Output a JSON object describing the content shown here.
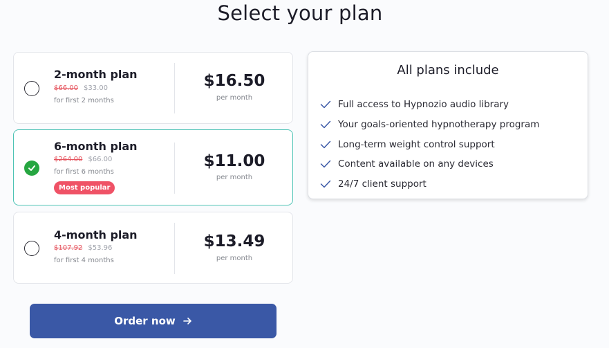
{
  "page": {
    "title": "Select your plan"
  },
  "plans": [
    {
      "name": "2-month plan",
      "old_price": "$66.00",
      "new_price": "$33.00",
      "period": "for first 2 months",
      "price": "$16.50",
      "per": "per month",
      "selected": false
    },
    {
      "name": "6-month plan",
      "old_price": "$264.00",
      "new_price": "$66.00",
      "period": "for first 6 months",
      "badge": "Most popular",
      "price": "$11.00",
      "per": "per month",
      "selected": true
    },
    {
      "name": "4-month plan",
      "old_price": "$107.92",
      "new_price": "$53.96",
      "period": "for first 4 months",
      "price": "$13.49",
      "per": "per month",
      "selected": false
    }
  ],
  "order": {
    "label": "Order now",
    "icon": "arrow-right-icon"
  },
  "includes": {
    "title": "All plans include",
    "items": [
      "Full access to Hypnozio audio library",
      "Your goals-oriented hypnotherapy program",
      "Long-term weight control support",
      "Content available on any devices",
      "24/7 client support"
    ],
    "icon": "check-icon"
  },
  "colors": {
    "accent": "#3a58a6",
    "selected_border": "#4ec3b5",
    "check_green": "#26a641",
    "badge": "#ef5266",
    "strike": "#e5535d"
  }
}
